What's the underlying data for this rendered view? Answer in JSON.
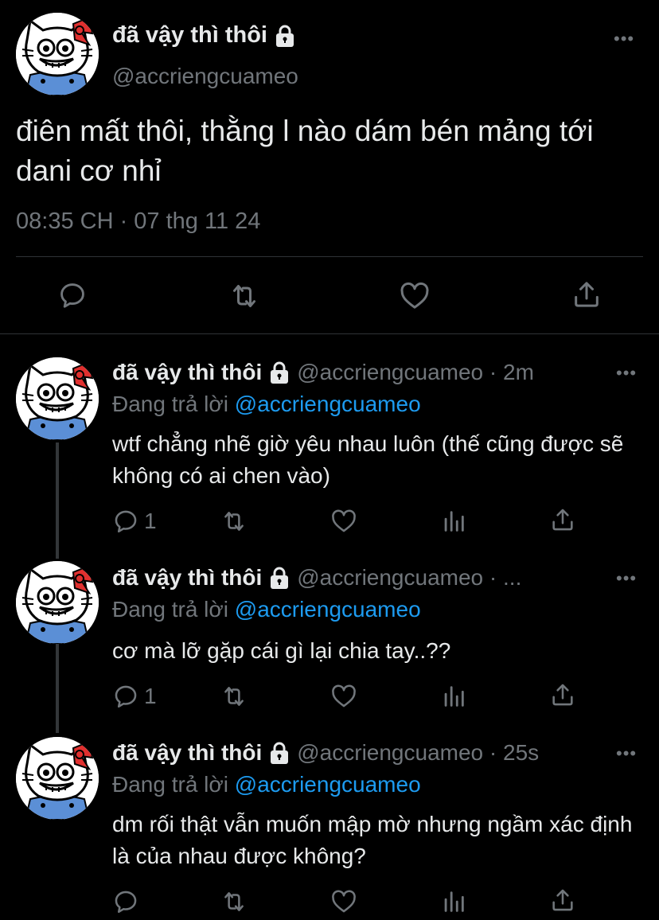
{
  "main_tweet": {
    "display_name": "đã vậy thì thôi",
    "handle": "@accriengcuameo",
    "text": "điên mất thôi, thằng l nào dám bén mảng tới dani cơ nhỉ",
    "timestamp": "08:35 CH · 07 thg 11 24",
    "actions": [
      "reply-icon",
      "retweet-icon",
      "like-icon",
      "share-icon"
    ]
  },
  "replies": [
    {
      "display_name": "đã vậy thì thôi",
      "meta": "@accriengcuameo · 2m",
      "replying_prefix": "Đang trả lời",
      "replying_to": "@accriengcuameo",
      "text": "wtf chẳng nhẽ giờ yêu nhau luôn (thế cũng được sẽ không có ai chen vào)",
      "reply_count": "1"
    },
    {
      "display_name": "đã vậy thì thôi",
      "meta": "@accriengcuameo · ...",
      "replying_prefix": "Đang trả lời",
      "replying_to": "@accriengcuameo",
      "text": "cơ mà lỡ gặp cái gì lại chia tay..??",
      "reply_count": "1"
    },
    {
      "display_name": "đã vậy thì thôi",
      "meta": "@accriengcuameo · 25s",
      "replying_prefix": "Đang trả lời",
      "replying_to": "@accriengcuameo",
      "text": "dm rối thật vẫn muốn mập mờ nhưng ngầm xác định là của nhau được không?",
      "reply_count": ""
    }
  ],
  "icons": {
    "lock": "lock-icon",
    "more": "more-icon",
    "reply": "reply-icon",
    "retweet": "retweet-icon",
    "like": "like-icon",
    "views": "views-icon",
    "share": "share-icon"
  },
  "colors": {
    "background": "#000000",
    "text": "#e7e9ea",
    "muted": "#71767b",
    "mention": "#1d9bf0",
    "divider": "#2f3336"
  }
}
